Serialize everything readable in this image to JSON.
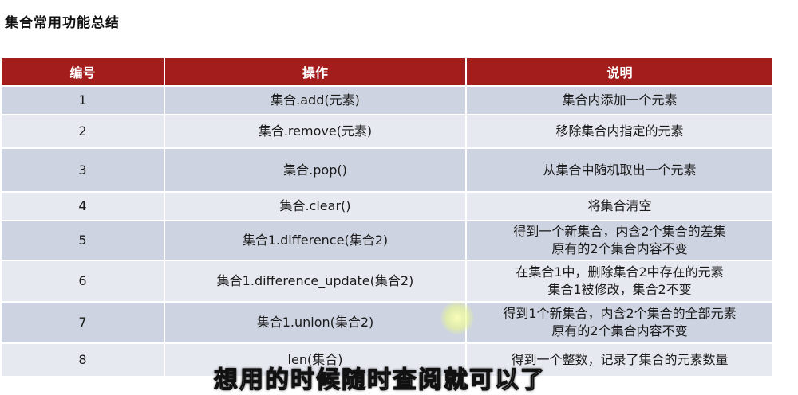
{
  "page": {
    "title": "集合常用功能总结",
    "subtitle": "想用的时候随时查阅就可以了"
  },
  "table": {
    "headers": [
      "编号",
      "操作",
      "说明"
    ],
    "rows": [
      {
        "num": "1",
        "op": "集合.add(元素)",
        "desc": [
          "集合内添加一个元素"
        ]
      },
      {
        "num": "2",
        "op": "集合.remove(元素)",
        "desc": [
          "移除集合内指定的元素"
        ]
      },
      {
        "num": "3",
        "op": "集合.pop()",
        "desc": [
          "从集合中随机取出一个元素"
        ]
      },
      {
        "num": "4",
        "op": "集合.clear()",
        "desc": [
          "将集合清空"
        ]
      },
      {
        "num": "5",
        "op": "集合1.difference(集合2)",
        "desc": [
          "得到一个新集合，内含2个集合的差集",
          "原有的2个集合内容不变"
        ]
      },
      {
        "num": "6",
        "op": "集合1.difference_update(集合2)",
        "desc": [
          "在集合1中，删除集合2中存在的元素",
          "集合1被修改，集合2不变"
        ]
      },
      {
        "num": "7",
        "op": "集合1.union(集合2)",
        "desc": [
          "得到1个新集合，内含2个集合的全部元素",
          "原有的2个集合内容不变"
        ]
      },
      {
        "num": "8",
        "op": "len(集合)",
        "desc": [
          "得到一个整数，记录了集合的元素数量"
        ]
      }
    ]
  },
  "colors": {
    "header_bg": "#a31d1d",
    "row_odd": "#cdd3e0",
    "row_even": "#e6e9f0"
  }
}
